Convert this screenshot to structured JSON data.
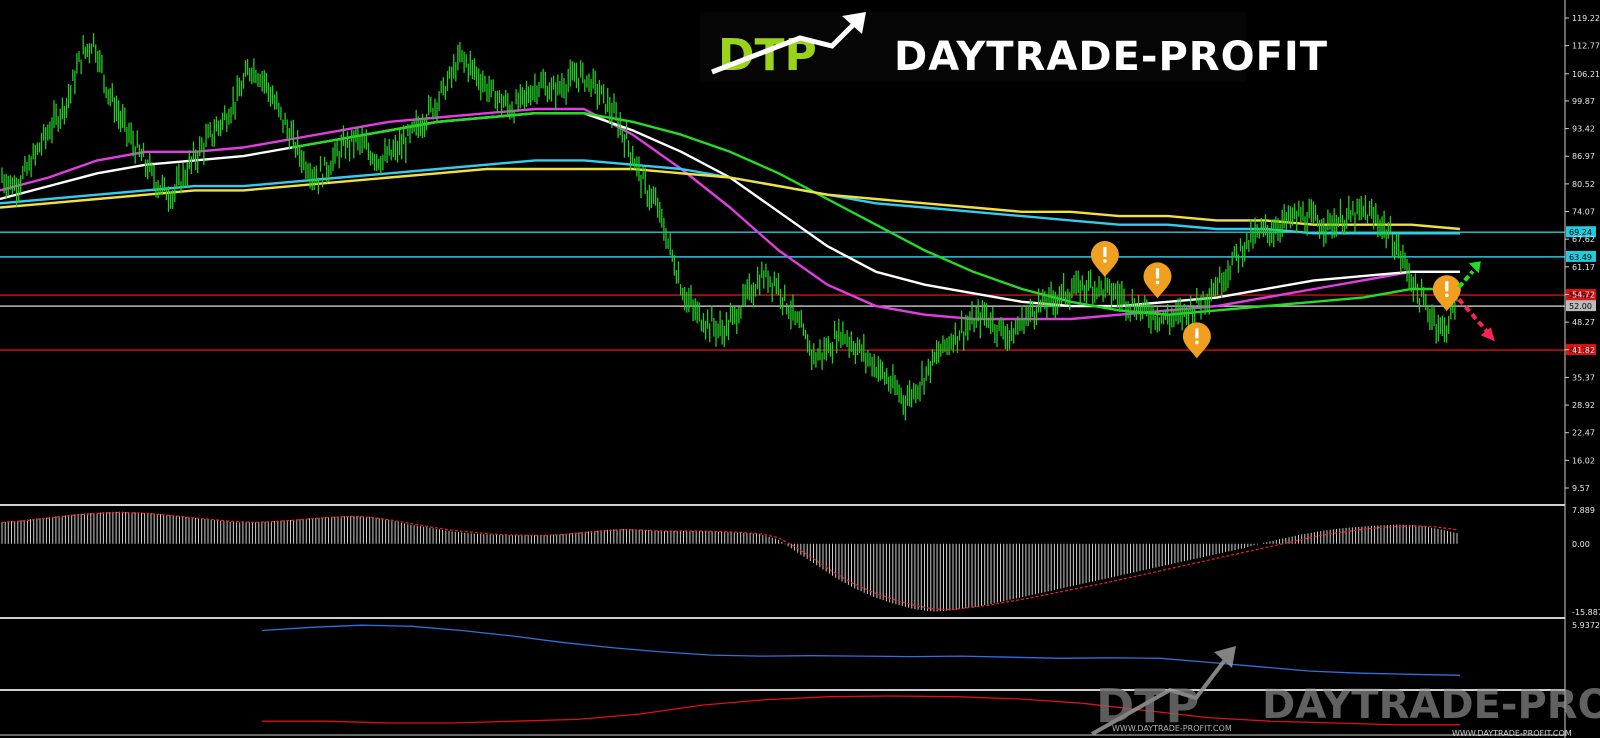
{
  "branding": {
    "logo_monogram": "DTP",
    "logo_text": "DAYTRADE-PROFIT",
    "watermark_monogram": "DTP",
    "watermark_text": "DAYTRADE-PROFIT",
    "watermark_url_small": "WWW.DAYTRADE-PROFIT.COM",
    "footer_url": "WWW.DAYTRADE-PROFIT.COM"
  },
  "colors": {
    "background": "#000000",
    "candles": "#22cc22",
    "ma_magenta": "#e23de2",
    "ma_white": "#ffffff",
    "ma_green": "#22dd22",
    "ma_cyan": "#33ccee",
    "ma_yellow": "#f0e040",
    "resistance_cyan": "#22ccdd",
    "support_red": "#dd1111",
    "pivot_gray": "#bbbbbb",
    "alert_marker": "#f0a020",
    "arrow_up": "#22dd22",
    "arrow_down": "#ff2255",
    "macd_hist": "#cccccc",
    "macd_signal": "#ee2222",
    "ind2_line": "#2f6fe0",
    "ind3_line": "#dd1111"
  },
  "chart_data": [
    {
      "type": "line",
      "panel": "price",
      "title": "",
      "ylim": [
        9.57,
        119.22
      ],
      "y_ticks": [
        "119.22",
        "112.77",
        "106.21",
        "99.87",
        "93.42",
        "86.97",
        "80.52",
        "74.07",
        "67.62",
        "61.17",
        "54.72",
        "48.27",
        "41.82",
        "35.37",
        "28.92",
        "22.47",
        "16.02",
        "9.57"
      ],
      "price_path": [
        82,
        80,
        84,
        90,
        95,
        100,
        110,
        114,
        103,
        96,
        90,
        85,
        80,
        78,
        83,
        88,
        92,
        96,
        101,
        108,
        105,
        98,
        92,
        86,
        82,
        85,
        89,
        91,
        88,
        86,
        88,
        91,
        95,
        99,
        104,
        110,
        107,
        103,
        100,
        98,
        101,
        104,
        102,
        104,
        106,
        104,
        100,
        95,
        88,
        80,
        75,
        65,
        55,
        50,
        48,
        46,
        50,
        55,
        59,
        58,
        52,
        46,
        40,
        42,
        46,
        43,
        40,
        37,
        33,
        30,
        34,
        39,
        43,
        46,
        48,
        50,
        47,
        45,
        49,
        52,
        53,
        55,
        56,
        57,
        56,
        55,
        53,
        51,
        50,
        49,
        50,
        52,
        55,
        58,
        63,
        67,
        69,
        70,
        72,
        73,
        72,
        71,
        72,
        73,
        74,
        72,
        68,
        62,
        55,
        50,
        46,
        53
      ],
      "ma_series": [
        {
          "color_key": "ma_magenta",
          "values": [
            79,
            82,
            86,
            88,
            88,
            89,
            91,
            93,
            95,
            96,
            97,
            98,
            98,
            92,
            84,
            75,
            65,
            57,
            52,
            50,
            49,
            49,
            49,
            50,
            51,
            52,
            54,
            56,
            58,
            60,
            60
          ]
        },
        {
          "color_key": "ma_white",
          "values": [
            77,
            80,
            83,
            85,
            86,
            87,
            89,
            91,
            93,
            95,
            96,
            97,
            97,
            93,
            88,
            82,
            74,
            66,
            60,
            57,
            55,
            53,
            52,
            52,
            53,
            54,
            56,
            58,
            59,
            60,
            60
          ]
        },
        {
          "color_key": "ma_green",
          "values": [
            null,
            null,
            null,
            null,
            null,
            null,
            89,
            91,
            93,
            95,
            96,
            97,
            97,
            95,
            92,
            88,
            83,
            77,
            71,
            65,
            60,
            56,
            53,
            51,
            50,
            51,
            52,
            53,
            54,
            56,
            56
          ]
        },
        {
          "color_key": "ma_cyan",
          "values": [
            76,
            77,
            78,
            79,
            80,
            80,
            81,
            82,
            83,
            84,
            85,
            86,
            86,
            85,
            84,
            82,
            80,
            78,
            76,
            75,
            74,
            73,
            72,
            71,
            71,
            70,
            70,
            69,
            69,
            69,
            69
          ]
        },
        {
          "color_key": "ma_yellow",
          "values": [
            75,
            76,
            77,
            78,
            79,
            79,
            80,
            81,
            82,
            83,
            84,
            84,
            84,
            84,
            83,
            82,
            80,
            78,
            77,
            76,
            75,
            74,
            74,
            73,
            73,
            72,
            72,
            71,
            71,
            71,
            70
          ]
        }
      ],
      "levels": [
        {
          "value": 69.24,
          "label": "69.24",
          "color_key": "resistance_cyan"
        },
        {
          "value": 63.49,
          "label": "63.49",
          "color_key": "resistance_cyan"
        },
        {
          "value": 54.59,
          "label": "54.59",
          "color_key": "support_red"
        },
        {
          "value": 52.0,
          "label": "52.00",
          "color_key": "pivot_gray"
        },
        {
          "value": 41.75,
          "label": "41.75",
          "color_key": "support_red"
        }
      ],
      "alert_markers": [
        {
          "x_index": 84,
          "value": 63
        },
        {
          "x_index": 88,
          "value": 58
        },
        {
          "x_index": 91,
          "value": 44
        },
        {
          "x_index": 110,
          "value": 55
        }
      ],
      "arrows": [
        {
          "direction": "up",
          "color_key": "arrow_up"
        },
        {
          "direction": "down",
          "color_key": "arrow_down"
        }
      ]
    },
    {
      "type": "bar",
      "panel": "oscillator",
      "ylim": [
        -15.887,
        7.889
      ],
      "y_ticks": [
        "7.889",
        "0.00",
        "-15.887"
      ],
      "histogram": [
        5,
        5.5,
        6,
        6.5,
        7,
        7.3,
        7.5,
        7.3,
        7,
        6.5,
        6,
        5.5,
        5,
        5,
        5.3,
        5.6,
        6,
        6.3,
        6.5,
        6.3,
        5.5,
        4.5,
        3.8,
        3,
        2.5,
        2.2,
        2,
        2,
        2,
        2.3,
        2.8,
        3.2,
        3.5,
        3.3,
        3,
        3,
        3,
        2.8,
        2.6,
        2.3,
        1,
        -2,
        -5,
        -8,
        -10.5,
        -12.5,
        -14,
        -15.2,
        -15.8,
        -15.5,
        -14.8,
        -14,
        -13,
        -12,
        -11,
        -10,
        -9,
        -8,
        -7,
        -6,
        -5,
        -4,
        -3,
        -2,
        -1,
        0.2,
        1.2,
        2.2,
        3,
        3.6,
        4,
        4.3,
        4.5,
        4.3,
        3.5,
        2.5
      ],
      "signal": [
        5,
        5.3,
        5.8,
        6.3,
        6.8,
        7.1,
        7.3,
        7.2,
        6.9,
        6.5,
        6,
        5.6,
        5.2,
        5,
        5.2,
        5.5,
        5.9,
        6.2,
        6.4,
        6.2,
        5.6,
        4.8,
        4,
        3.3,
        2.8,
        2.4,
        2.1,
        2,
        2,
        2.2,
        2.6,
        3,
        3.3,
        3.2,
        3,
        3,
        3,
        2.9,
        2.7,
        2.4,
        1.5,
        -1,
        -4,
        -7,
        -9.5,
        -11.5,
        -13,
        -14.3,
        -15.2,
        -15.3,
        -14.8,
        -14.2,
        -13.4,
        -12.6,
        -11.7,
        -10.8,
        -9.9,
        -9,
        -8,
        -7,
        -6,
        -5,
        -4,
        -3,
        -2,
        -1,
        0,
        1,
        2,
        2.7,
        3.3,
        3.8,
        4.1,
        4.2,
        3.9,
        3.3
      ]
    },
    {
      "type": "line",
      "panel": "indicator-2",
      "y_ticks": [
        "5.9372"
      ],
      "values": [
        5.6,
        5.75,
        5.85,
        5.8,
        5.6,
        5.35,
        5.05,
        4.8,
        4.6,
        4.45,
        4.4,
        4.42,
        4.4,
        4.38,
        4.4,
        4.35,
        4.3,
        4.32,
        4.3,
        4.1,
        3.9,
        3.7,
        3.6,
        3.55,
        3.5
      ]
    },
    {
      "type": "line",
      "panel": "indicator-3",
      "values": [
        0.3,
        0.3,
        0.25,
        0.25,
        0.3,
        0.35,
        0.5,
        0.75,
        0.9,
        0.98,
        1.0,
        0.98,
        0.92,
        0.8,
        0.6,
        0.4,
        0.3,
        0.25,
        0.2,
        0.2
      ]
    }
  ]
}
